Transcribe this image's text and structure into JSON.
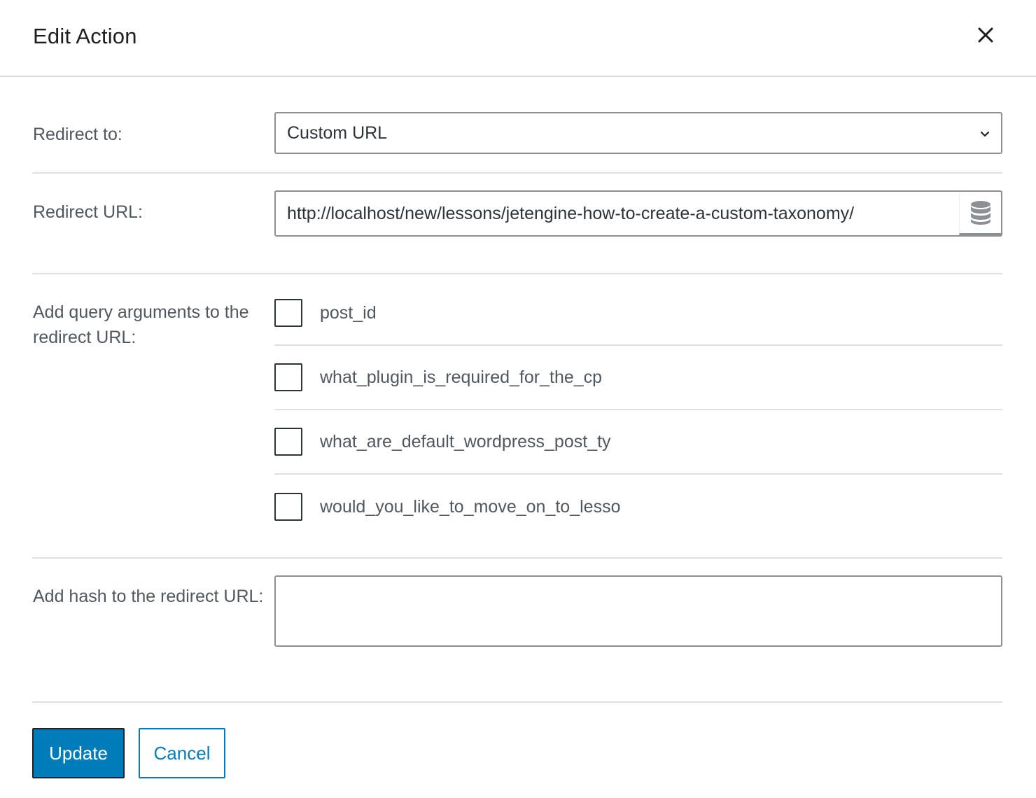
{
  "header": {
    "title": "Edit Action",
    "close_icon": "close-icon"
  },
  "redirect_to": {
    "label": "Redirect to:",
    "value": "Custom URL",
    "icon": "chevron-down-icon"
  },
  "redirect_url": {
    "label": "Redirect URL:",
    "value": "http://localhost/new/lessons/jetengine-how-to-create-a-custom-taxonomy/",
    "icon": "database-icon"
  },
  "query_args": {
    "label": "Add query arguments to the redirect URL:",
    "options": [
      {
        "label": "post_id",
        "checked": false
      },
      {
        "label": "what_plugin_is_required_for_the_cp",
        "checked": false
      },
      {
        "label": "what_are_default_wordpress_post_ty",
        "checked": false
      },
      {
        "label": "would_you_like_to_move_on_to_lesso",
        "checked": false
      }
    ]
  },
  "hash": {
    "label": "Add hash to the redirect URL:",
    "value": ""
  },
  "actions": {
    "update_label": "Update",
    "cancel_label": "Cancel"
  },
  "colors": {
    "primary": "#007cba",
    "border": "#8c8f94",
    "divider": "#e0e0e0",
    "label_text": "#50575e"
  }
}
